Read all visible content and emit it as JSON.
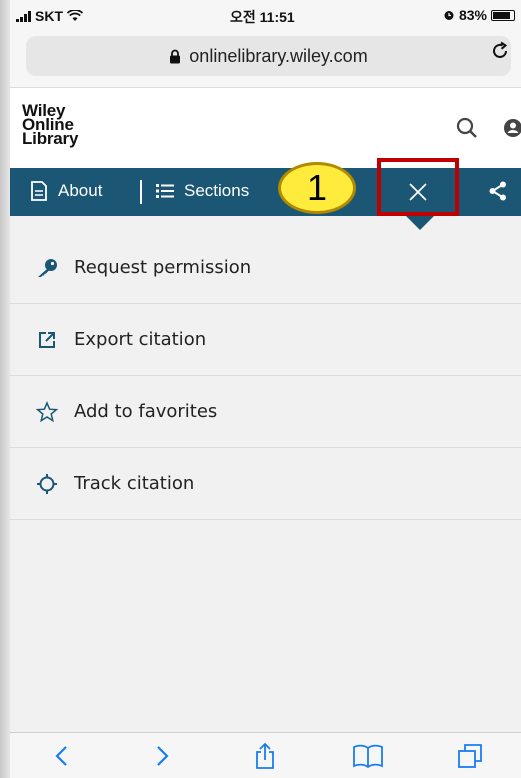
{
  "status_bar": {
    "carrier": "SKT",
    "time": "오전 11:51",
    "battery": "83%",
    "battery_level": 0.83
  },
  "browser": {
    "url": "onlinelibrary.wiley.com"
  },
  "site": {
    "logo_lines": [
      "Wiley",
      "Online",
      "Library"
    ]
  },
  "nav": {
    "about_label": "About",
    "sections_label": "Sections"
  },
  "annotation": {
    "callout_number": "1"
  },
  "menu": {
    "items": [
      {
        "label": "Request permission",
        "icon": "key-icon"
      },
      {
        "label": "Export citation",
        "icon": "export-icon"
      },
      {
        "label": "Add to favorites",
        "icon": "star-icon"
      },
      {
        "label": "Track citation",
        "icon": "target-icon"
      }
    ]
  },
  "colors": {
    "nav_bar": "#1b5674",
    "accent_red": "#c00000",
    "callout_yellow": "#ffeb3b",
    "ios_blue": "#1a7cf5"
  }
}
